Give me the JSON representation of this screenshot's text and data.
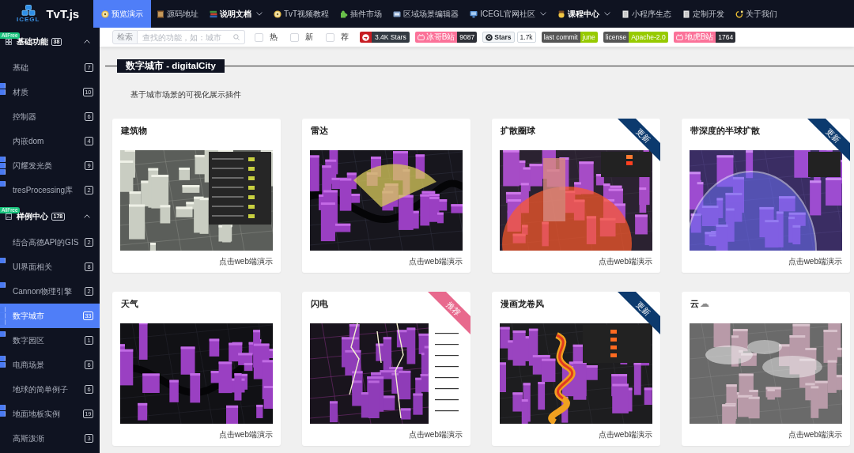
{
  "nav": {
    "logo": {
      "caption": "ICEGL",
      "text": "TvT.js"
    },
    "items": [
      {
        "label": "预览演示",
        "selected": true,
        "emphasized": false,
        "dropdown": false
      },
      {
        "label": "源码地址",
        "selected": false,
        "emphasized": false,
        "dropdown": false
      },
      {
        "label": "说明文档",
        "selected": false,
        "emphasized": true,
        "dropdown": true
      },
      {
        "label": "TvT视频教程",
        "selected": false,
        "emphasized": false,
        "dropdown": false
      },
      {
        "label": "插件市场",
        "selected": false,
        "emphasized": false,
        "dropdown": false
      },
      {
        "label": "区域场景编辑器",
        "selected": false,
        "emphasized": false,
        "dropdown": false
      },
      {
        "label": "ICEGL官网社区",
        "selected": false,
        "emphasized": false,
        "dropdown": true
      },
      {
        "label": "课程中心",
        "selected": false,
        "emphasized": true,
        "dropdown": true
      },
      {
        "label": "小程序生态",
        "selected": false,
        "emphasized": false,
        "dropdown": false
      },
      {
        "label": "定制开发",
        "selected": false,
        "emphasized": false,
        "dropdown": false
      },
      {
        "label": "关于我们",
        "selected": false,
        "emphasized": false,
        "dropdown": false
      }
    ]
  },
  "sidebar": {
    "groups": [
      {
        "badge": "AllFree",
        "title": "基础功能",
        "count": "38",
        "expanded": true,
        "items": [
          {
            "label": "基础",
            "count": "7",
            "selected": false,
            "recommended": false,
            "new": false,
            "hot": false
          },
          {
            "label": "材质",
            "count": "10",
            "selected": false,
            "recommended": true,
            "new": false,
            "hot": true
          },
          {
            "label": "控制器",
            "count": "6",
            "selected": false,
            "recommended": false,
            "new": false,
            "hot": false
          },
          {
            "label": "内嵌dom",
            "count": "4",
            "selected": false,
            "recommended": false,
            "new": false,
            "hot": false
          },
          {
            "label": "闪耀发光类",
            "count": "9",
            "selected": false,
            "recommended": true,
            "new": true,
            "hot": true
          },
          {
            "label": "tresProcessing库",
            "count": "2",
            "selected": false,
            "recommended": false,
            "new": false,
            "hot": true
          }
        ]
      },
      {
        "badge": "AllFree",
        "title": "样例中心",
        "count": "178",
        "expanded": true,
        "items": [
          {
            "label": "结合高德API的GIS",
            "count": "2",
            "selected": false,
            "recommended": false,
            "new": false,
            "hot": false
          },
          {
            "label": "UI界面相关",
            "count": "8",
            "selected": false,
            "recommended": true,
            "new": false,
            "hot": false
          },
          {
            "label": "Cannon物理引擎",
            "count": "2",
            "selected": false,
            "recommended": false,
            "new": false,
            "hot": true
          },
          {
            "label": "数字城市",
            "count": "33",
            "selected": true,
            "recommended": true,
            "new": true,
            "hot": true
          },
          {
            "label": "数字园区",
            "count": "1",
            "selected": false,
            "recommended": true,
            "new": false,
            "hot": false
          },
          {
            "label": "电商场景",
            "count": "6",
            "selected": false,
            "recommended": true,
            "new": false,
            "hot": true
          },
          {
            "label": "地球的简单例子",
            "count": "6",
            "selected": false,
            "recommended": false,
            "new": false,
            "hot": false
          },
          {
            "label": "地面地板实例",
            "count": "19",
            "selected": false,
            "recommended": true,
            "new": false,
            "hot": true
          },
          {
            "label": "高斯泼渐",
            "count": "3",
            "selected": false,
            "recommended": false,
            "new": false,
            "hot": false
          }
        ]
      }
    ]
  },
  "toolbar": {
    "search": {
      "label": "检索",
      "placeholder": "查找的功能，如：城市"
    },
    "filters": [
      {
        "label": "热",
        "checked": false
      },
      {
        "label": "新",
        "checked": false
      },
      {
        "label": "荐",
        "checked": false
      }
    ],
    "badges": [
      {
        "kind": "gitee",
        "label": "3.4K Stars"
      },
      {
        "kind": "bilibili",
        "label": "冰哥B站",
        "value": "9087"
      },
      {
        "kind": "github",
        "label": "Stars",
        "value": "1.7k"
      },
      {
        "kind": "plain",
        "label": "last commit",
        "value": "june"
      },
      {
        "kind": "plain",
        "label": "license",
        "value": "Apache-2.0"
      },
      {
        "kind": "bilibili",
        "label": "地虎B站",
        "value": "1764"
      }
    ]
  },
  "section": {
    "title": "数字城市 - digitalCity",
    "description": "基于城市场景的可视化展示插件"
  },
  "cards": [
    {
      "title": "建筑物",
      "link": "点击web端演示"
    },
    {
      "title": "雷达",
      "link": "点击web端演示"
    },
    {
      "title": "扩散圈球",
      "link": "点击web端演示",
      "ribbon": {
        "kind": "update",
        "text": "更新"
      }
    },
    {
      "title": "带深度的半球扩散",
      "link": "点击web端演示",
      "ribbon": {
        "kind": "update",
        "text": "更新"
      }
    },
    {
      "title": "天气",
      "link": "点击web端演示"
    },
    {
      "title": "闪电",
      "link": "点击web端演示",
      "ribbon": {
        "kind": "recommend",
        "text": "推荐"
      }
    },
    {
      "title": "漫画龙卷风",
      "link": "点击web端演示",
      "ribbon": {
        "kind": "update",
        "text": "更新"
      }
    },
    {
      "title": "云",
      "symbol": "☁",
      "link": "点击web端演示"
    }
  ]
}
